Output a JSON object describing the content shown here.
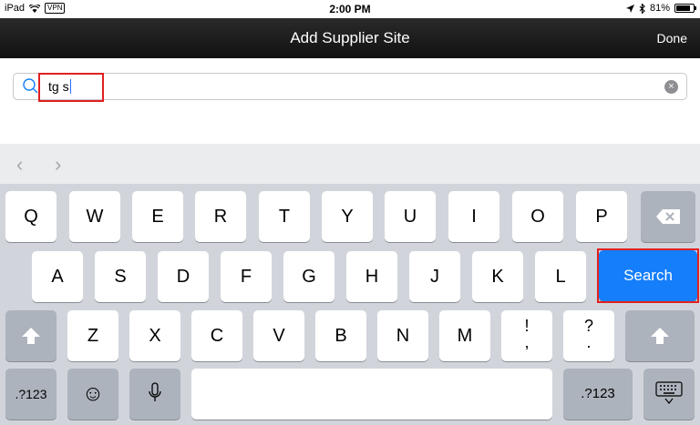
{
  "statusbar": {
    "device": "iPad",
    "vpn": "VPN",
    "time": "2:00 PM",
    "battery": "81%",
    "battery_level": 0.81
  },
  "navbar": {
    "title": "Add Supplier Site",
    "done": "Done"
  },
  "search": {
    "value": "tg s",
    "clear_glyph": "×"
  },
  "toolbar": {
    "prev": "‹",
    "next": "›"
  },
  "keyboard": {
    "row1": [
      "Q",
      "W",
      "E",
      "R",
      "T",
      "Y",
      "U",
      "I",
      "O",
      "P"
    ],
    "row2": [
      "A",
      "S",
      "D",
      "F",
      "G",
      "H",
      "J",
      "K",
      "L"
    ],
    "row3": [
      "Z",
      "X",
      "C",
      "V",
      "B",
      "N",
      "M"
    ],
    "punct1": [
      "!",
      ","
    ],
    "punct2": [
      "?",
      "."
    ],
    "search_key": "Search",
    "numbers_left": ".?123",
    "numbers_right": ".?123",
    "emoji": "☺",
    "shift": "⇧"
  },
  "colors": {
    "accent": "#147efb",
    "highlight": "#e02020",
    "navbar": "#1a1a1a"
  }
}
